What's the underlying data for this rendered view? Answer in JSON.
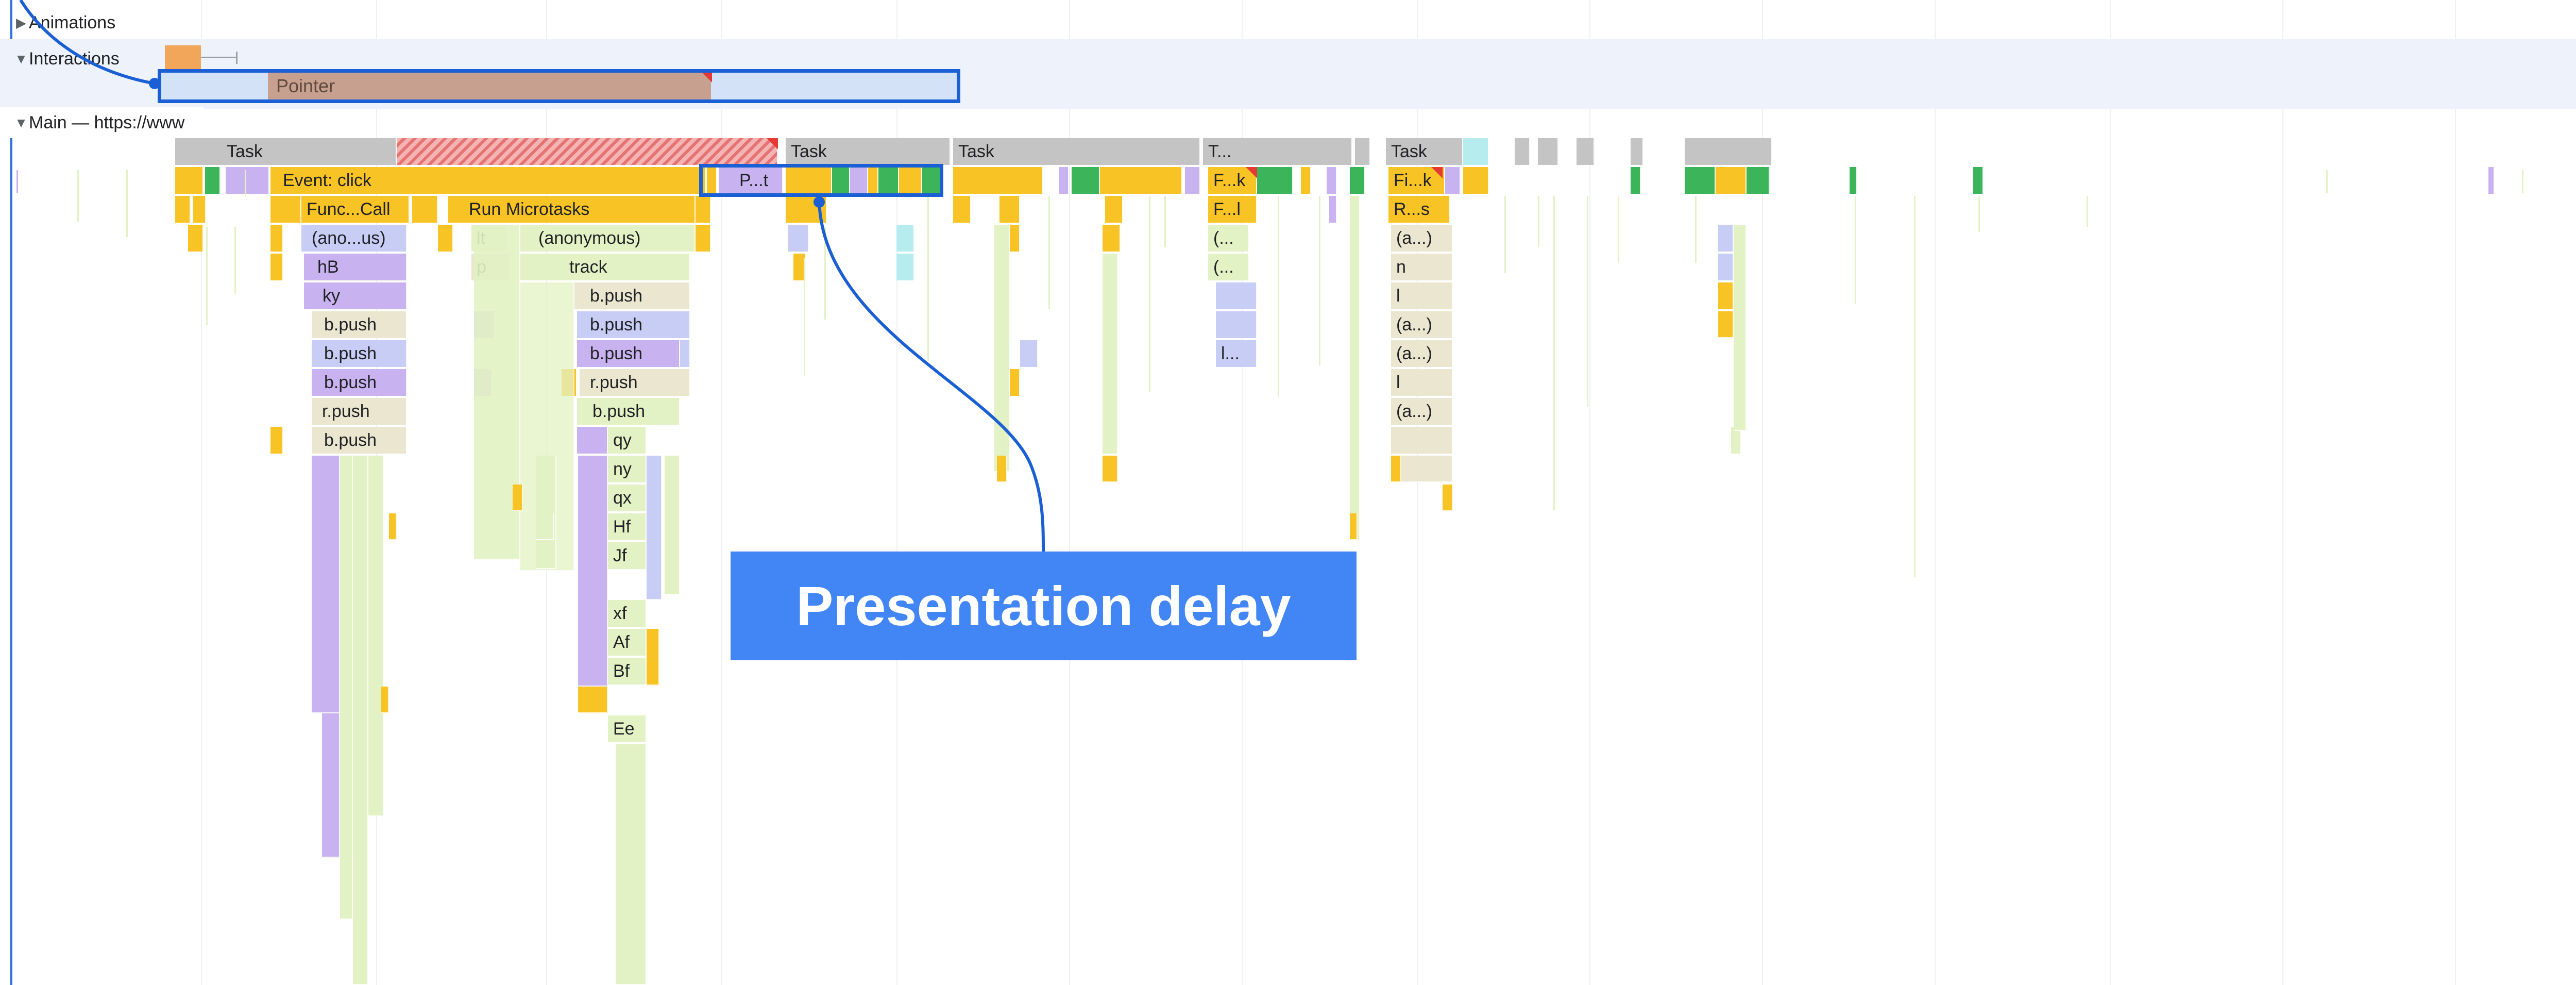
{
  "tracks": {
    "animations_label": "Animations",
    "interactions_label": "Interactions",
    "main_label": "Main — https://www"
  },
  "interaction": {
    "pointer_label": "Pointer"
  },
  "flame": {
    "task_labels": [
      "Task",
      "Task",
      "Task",
      "T...",
      "Task"
    ],
    "row1_labels": [
      "Event: click",
      "P...t",
      "F...k",
      "Fi...k"
    ],
    "row2_labels": [
      "Func...Call",
      "Run Microtasks",
      "F...l",
      "R...s"
    ],
    "row3_labels": [
      "(ano...us)",
      "lt",
      "(anonymous)",
      "(...",
      "(a...)"
    ],
    "row4_labels": [
      "hB",
      "p",
      "track",
      "(...",
      "n"
    ],
    "row5_labels": [
      "ky",
      "b.push",
      "l"
    ],
    "row6_labels": [
      "b.push",
      "b.push",
      "(a...)"
    ],
    "row7_labels": [
      "b.push",
      "b.push",
      "l...",
      "(a...)"
    ],
    "row8_labels": [
      "b.push",
      "r.push",
      "l"
    ],
    "row9_labels": [
      "r.push",
      "b.push",
      "(a...)"
    ],
    "row10_labels": [
      "b.push",
      "qy"
    ],
    "deep_labels": [
      "ny",
      "qx",
      "Hf",
      "Jf",
      "xf",
      "Af",
      "Bf",
      "Ee"
    ]
  },
  "annotation": {
    "callout_text": "Presentation delay"
  },
  "colors": {
    "task_gray": "#c4c4c4",
    "event_yellow": "#f7c325",
    "function_beige": "#ebe6cf",
    "script_green": "#e3f2c4",
    "purple": "#c8b3f0",
    "lavender": "#c7cdf5",
    "paint_green": "#3cb55a",
    "cyan": "#b7ecee",
    "highlight_blue": "#1a5fd4",
    "callout_blue": "#4285f4",
    "long_task_red": "#e53935",
    "interactions_bg": "#eef3fb",
    "pointer_fill": "#c7a090",
    "pointer_wait": "#d4e2f7"
  }
}
